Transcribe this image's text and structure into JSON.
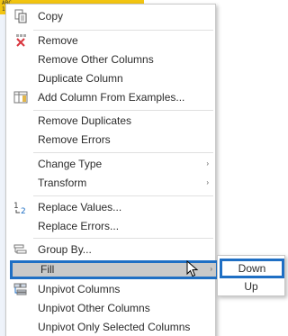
{
  "sheet": {
    "cell_label": "ABC",
    "cell_number": "1.2",
    "colors": {
      "header": "#f2c511"
    }
  },
  "menu": {
    "items": [
      {
        "label": "Copy",
        "icon": "copy-icon"
      },
      {
        "label": "Remove",
        "icon": "remove-column-icon"
      },
      {
        "label": "Remove Other Columns",
        "icon": null
      },
      {
        "label": "Duplicate Column",
        "icon": null
      },
      {
        "label": "Add Column From Examples...",
        "icon": "column-from-examples-icon"
      },
      {
        "label": "Remove Duplicates",
        "icon": null
      },
      {
        "label": "Remove Errors",
        "icon": null
      },
      {
        "label": "Change Type",
        "icon": null,
        "has_submenu": true
      },
      {
        "label": "Transform",
        "icon": null,
        "has_submenu": true
      },
      {
        "label": "Replace Values...",
        "icon": "replace-values-icon"
      },
      {
        "label": "Replace Errors...",
        "icon": null
      },
      {
        "label": "Group By...",
        "icon": "group-by-icon"
      },
      {
        "label": "Fill",
        "icon": null,
        "has_submenu": true,
        "highlighted": true
      },
      {
        "label": "Unpivot Columns",
        "icon": "unpivot-icon"
      },
      {
        "label": "Unpivot Other Columns",
        "icon": null
      },
      {
        "label": "Unpivot Only Selected Columns",
        "icon": null
      }
    ],
    "submenu_arrow": "›"
  },
  "fill_submenu": {
    "items": [
      {
        "label": "Down",
        "highlighted": true
      },
      {
        "label": "Up"
      }
    ]
  },
  "colors": {
    "highlight_border": "#1f6fc4",
    "highlight_fill": "#c9c9c9",
    "remove_icon": "#d9363e"
  }
}
